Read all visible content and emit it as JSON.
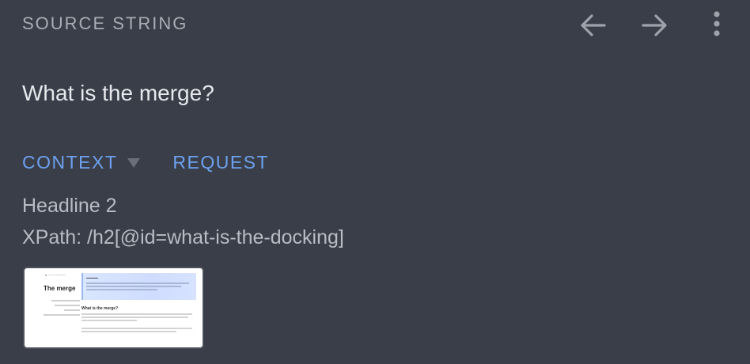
{
  "header": {
    "label": "SOURCE STRING",
    "back_icon": "arrow-left-icon",
    "forward_icon": "arrow-right-icon",
    "more_icon": "more-vertical-icon"
  },
  "source": {
    "text": "What is the merge?"
  },
  "tabs": [
    {
      "label": "CONTEXT",
      "has_dropdown": true
    },
    {
      "label": "REQUEST"
    }
  ],
  "context": {
    "element_type": "Headline 2",
    "xpath": "XPath: /h2[@id=what-is-the-docking]"
  },
  "thumbnail": {
    "page_title": "The merge",
    "section_heading": "What is the merge?"
  },
  "colors": {
    "background": "#393e48",
    "accent": "#6ea1f0",
    "header_text": "#a9adb5",
    "primary_text": "#e6e8ec",
    "secondary_text": "#b8bcc4"
  }
}
